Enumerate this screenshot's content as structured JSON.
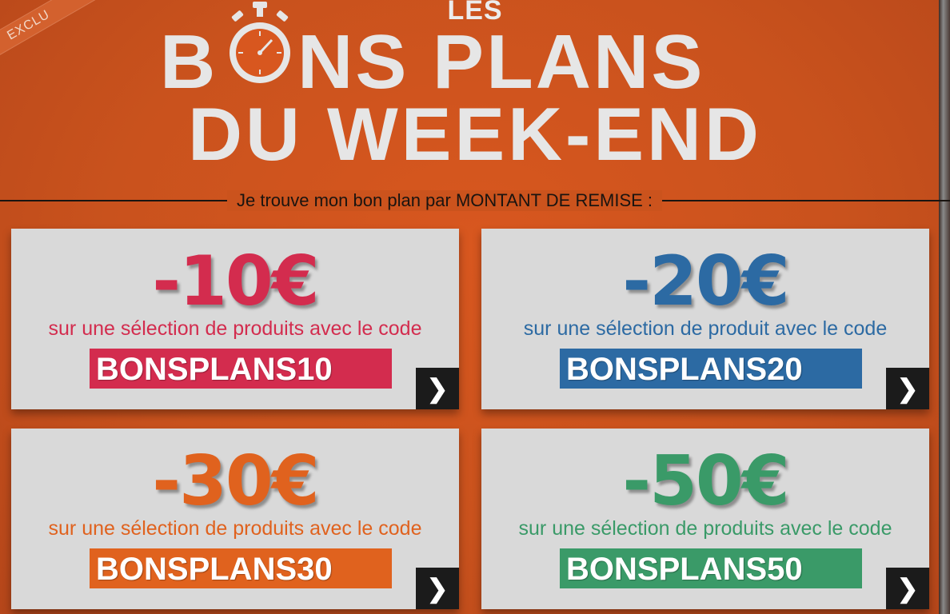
{
  "header": {
    "ribbon": "EXCLU",
    "les": "LES",
    "title_line1_left": "B",
    "title_line1_right": "NS PLANS",
    "title_line2": "DU WEEK-END"
  },
  "section_label": "Je trouve mon bon plan par MONTANT DE REMISE :",
  "colors": {
    "background": "#c9521d",
    "card": "#d9d9d9",
    "red": "#d32c4e",
    "blue": "#2c6aa3",
    "orange": "#e0621e",
    "green": "#3a9a68"
  },
  "offers": [
    {
      "amount": "-10€",
      "desc": "sur une sélection de produits avec le code",
      "code": "BONSPLANS10",
      "arrow": "❯"
    },
    {
      "amount": "-20€",
      "desc": "sur une sélection de produit avec le code",
      "code": "BONSPLANS20",
      "arrow": "❯"
    },
    {
      "amount": "-30€",
      "desc": "sur une sélection de produits avec le code",
      "code": "BONSPLANS30",
      "arrow": "❯"
    },
    {
      "amount": "-50€",
      "desc": "sur une sélection de produits avec le code",
      "code": "BONSPLANS50",
      "arrow": "❯"
    }
  ],
  "icons": {
    "stopwatch": "stopwatch-icon",
    "arrow": "chevron-right-icon"
  }
}
